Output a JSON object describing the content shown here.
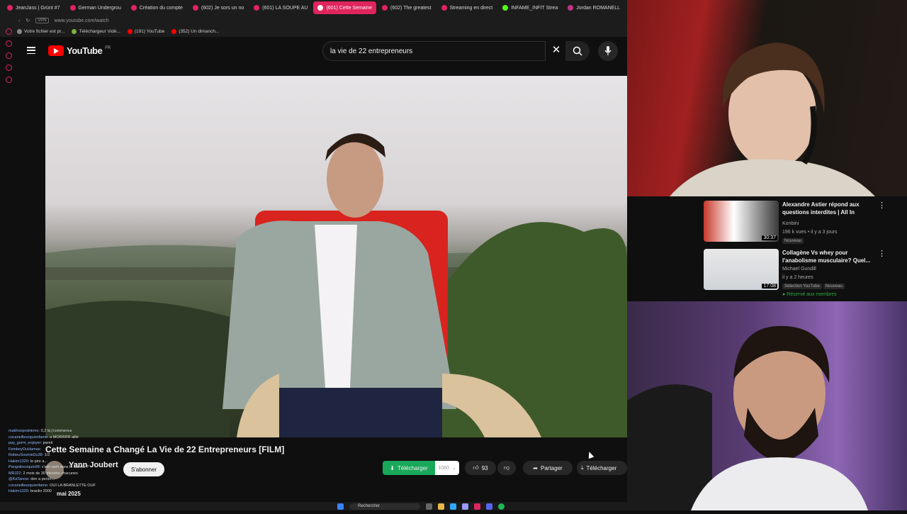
{
  "browser": {
    "tabs": [
      {
        "label": "JeanJass | Grünt #7"
      },
      {
        "label": "German Undergrou"
      },
      {
        "label": "Création du compte"
      },
      {
        "label": "(602) Je sors un no"
      },
      {
        "label": "(601) LA SOUPE AU"
      },
      {
        "label": "(601) Cette Semaine",
        "active": true
      },
      {
        "label": "(602) The greatest"
      },
      {
        "label": "Streaming en direct"
      },
      {
        "label": "INFAME_INFIT Strea"
      },
      {
        "label": "Jordan ROMANELL"
      }
    ],
    "vpn": "VPN",
    "url": "www.youtube.com/watch",
    "bookmarks": [
      "Votre fichier est pr...",
      "Téléchargeur Vidé...",
      "(191) YouTube",
      "(352) Un dimanch..."
    ]
  },
  "youtube": {
    "logo": "YouTube",
    "region": "FR",
    "search_value": "la vie de 22 entrepreneurs",
    "clear_glyph": "✕"
  },
  "video": {
    "title": "Cette Semaine a Changé La Vie de 22 Entrepreneurs [FILM]",
    "channel": "Yann Joubert",
    "subscribe": "S'abonner",
    "date": "mai 2025",
    "download_label": "Télécharger",
    "download_count": "1080",
    "likes": "93",
    "share": "Partager",
    "download2": "Télécharger"
  },
  "chat": [
    {
      "user": "makhnoproblemo:",
      "msg": "0,2 là j'commence"
    },
    {
      "user": "cocaneilleurquienfame:",
      "msg": "a MORRRR aille"
    },
    {
      "user": "pay_gorm_enjoyer:",
      "msg": "pareil"
    },
    {
      "user": "FemboyOuHamas:",
      "msg": ""
    },
    {
      "user": "RebeuSoumisDu38:",
      "msg": "1/2"
    },
    {
      "user": "Hakim1320:",
      "msg": "le pire a..."
    },
    {
      "user": "Pangolincoquin99:",
      "msg": "c'est cash dans le cadeur ?"
    },
    {
      "user": "MRJ22:",
      "msg": "2 mois de 30 minutes chacunes"
    },
    {
      "user": "@KaTanow:",
      "msg": "den a perso..."
    },
    {
      "user": "cocaneilleurquienfame:",
      "msg": "OUI LA BRANLETTE OUF"
    },
    {
      "user": "Hakim1320:",
      "msg": "branlix 2000"
    }
  ],
  "taskbar": {
    "search": "Rechercher"
  },
  "recommended": [
    {
      "title": "Alexandre Astier répond aux questions interdites | All In",
      "channel": "Konbini",
      "meta": "196 k vues • il y a 3 jours",
      "badge": "Nouveau",
      "duration": "30:37"
    },
    {
      "title": "Collagène Vs whey pour l'anabolisme musculaire? Quel...",
      "channel": "Michael Gundill",
      "meta": "il y a 2 heures",
      "badge": "Sélection YouTube",
      "badge2": "Nouveau",
      "extra": "Réservé aux membres",
      "duration": "17:08"
    }
  ],
  "colors": {
    "accent": "#ff0000",
    "download_green": "#19a85a",
    "tab_active": "#e0245e"
  }
}
